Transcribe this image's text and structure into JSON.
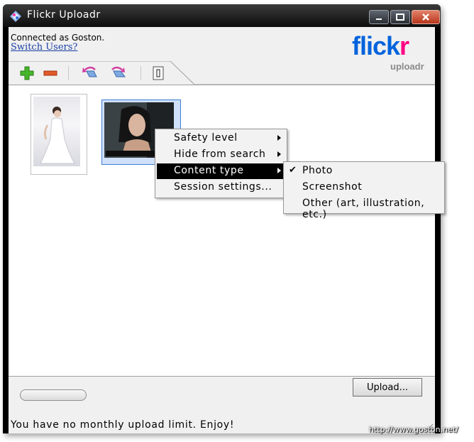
{
  "window": {
    "title": "Flickr  Uploadr",
    "controls": [
      "minimize",
      "maximize",
      "close"
    ]
  },
  "account": {
    "connected_text": "Connected as Goston.",
    "switch_label": "Switch Users?"
  },
  "logo": {
    "word_blue": "flick",
    "word_pink": "r",
    "subtitle": "uploadr"
  },
  "toolbar": {
    "icons": [
      "add-icon",
      "remove-icon",
      "rotate-left-icon",
      "rotate-right-icon",
      "info-icon"
    ]
  },
  "photos": [
    {
      "name": "bride-photo",
      "selected": false
    },
    {
      "name": "portrait-photo",
      "selected": true
    }
  ],
  "context_menu": {
    "items": [
      {
        "label": "Safety level",
        "has_submenu": true,
        "highlighted": false
      },
      {
        "label": "Hide from search",
        "has_submenu": true,
        "highlighted": false
      },
      {
        "label": "Content type",
        "has_submenu": true,
        "highlighted": true
      },
      {
        "label": "Session settings...",
        "has_submenu": false,
        "highlighted": false
      }
    ]
  },
  "submenu": {
    "items": [
      {
        "label": "Photo",
        "checked": true
      },
      {
        "label": "Screenshot",
        "checked": false
      },
      {
        "label": "Other (art, illustration, etc.)",
        "checked": false
      }
    ]
  },
  "footer": {
    "upload_label": "Upload...",
    "status_text": "You have no monthly upload limit.  Enjoy!"
  },
  "watermark": "http://www.goston.net/",
  "colors": {
    "flickr_blue": "#0063dc",
    "flickr_pink": "#ff0084",
    "menu_highlight": "#000000"
  }
}
